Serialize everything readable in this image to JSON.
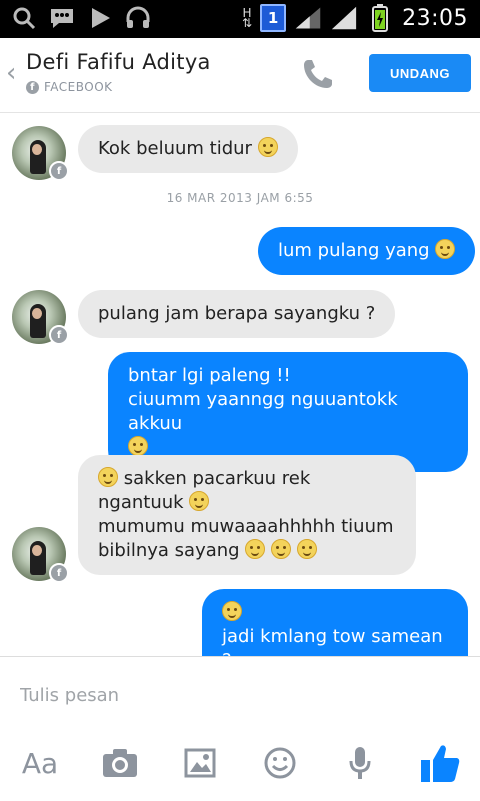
{
  "status_bar": {
    "time": "23:05",
    "sim_badge": "1",
    "network_type": "H",
    "battery_color": "#7ed321"
  },
  "header": {
    "back_icon": "chevron-left-icon",
    "contact_name": "Defi Fafifu Aditya",
    "contact_source": "FACEBOOK",
    "invite_label": "UNDANG"
  },
  "messages": [
    {
      "direction": "in",
      "lines": [
        "Kok beluum tidur"
      ],
      "emoji_after": true
    },
    {
      "timestamp": "16 MAR 2013 JAM 6:55"
    },
    {
      "direction": "out",
      "lines": [
        "lum pulang yang"
      ],
      "emoji_after": true
    },
    {
      "direction": "in",
      "lines": [
        "pulang jam berapa sayangku ?"
      ]
    },
    {
      "direction": "out",
      "lines": [
        "bntar lgi paleng !!",
        "ciuumm yaanngg nguuantokk akkuu"
      ],
      "emoji_line": true
    },
    {
      "direction": "in",
      "lines": [
        "sakken pacarkuu rek",
        "ngantuuk",
        "mumumu muwaaaahhhhh tiuum",
        "bibilnya sayang"
      ]
    },
    {
      "direction": "out",
      "lines": [
        "jadi kmlang tow samean ?"
      ],
      "emoji_line_before": true
    }
  ],
  "composer": {
    "placeholder": "Tulis pesan",
    "aa_label": "Aa",
    "like_color": "#0a84ff"
  },
  "colors": {
    "accent": "#0a84ff",
    "incoming_bubble": "#e9e9e9"
  }
}
